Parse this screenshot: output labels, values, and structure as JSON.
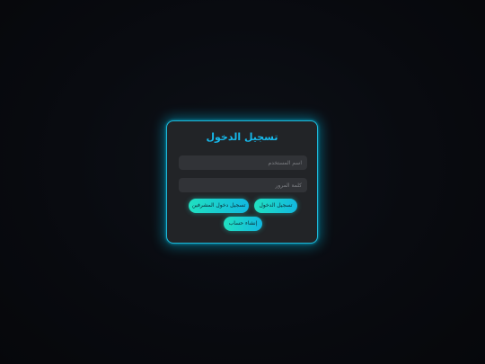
{
  "background": {
    "title": ""
  },
  "login_dialog": {
    "title": "تسجيل الدخول",
    "username_placeholder": "اسم المستخدم",
    "password_placeholder": "كلمة المرور",
    "login_button": "تسجيل الدخول",
    "admin_login_button": "تسجيل دخول المشرفين",
    "create_account_button": "إنشاء حساب"
  },
  "colors": {
    "accent": "#16b8ea",
    "button_start": "#20e0c0",
    "button_end": "#12b8e0",
    "dialog_bg": "#222427",
    "page_bg": "#0b0e14"
  }
}
